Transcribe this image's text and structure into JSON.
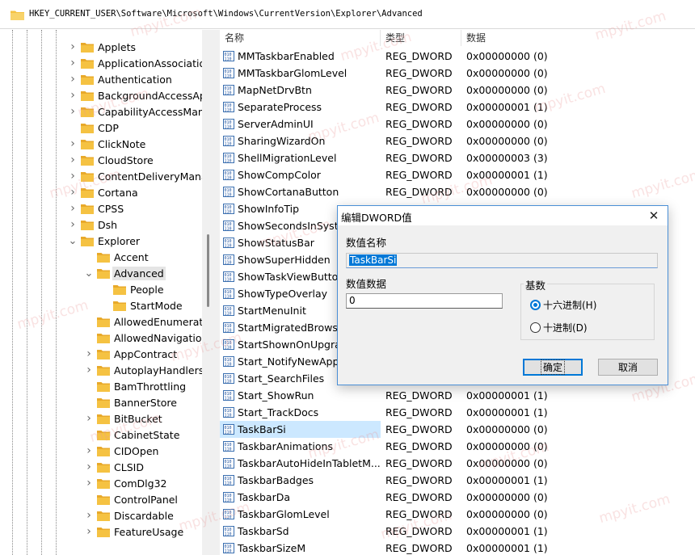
{
  "address": {
    "path": "HKEY_CURRENT_USER\\Software\\Microsoft\\Windows\\CurrentVersion\\Explorer\\Advanced"
  },
  "tree": {
    "items": [
      {
        "label": "Applets",
        "expand": "collapsed",
        "level": 0
      },
      {
        "label": "ApplicationAssociatio",
        "expand": "collapsed",
        "level": 0
      },
      {
        "label": "Authentication",
        "expand": "collapsed",
        "level": 0
      },
      {
        "label": "BackgroundAccessAp",
        "expand": "collapsed",
        "level": 0
      },
      {
        "label": "CapabilityAccessMana",
        "expand": "collapsed",
        "level": 0
      },
      {
        "label": "CDP",
        "expand": "none",
        "level": 0
      },
      {
        "label": "ClickNote",
        "expand": "collapsed",
        "level": 0
      },
      {
        "label": "CloudStore",
        "expand": "collapsed",
        "level": 0
      },
      {
        "label": "ContentDeliveryManag",
        "expand": "collapsed",
        "level": 0
      },
      {
        "label": "Cortana",
        "expand": "collapsed",
        "level": 0
      },
      {
        "label": "CPSS",
        "expand": "collapsed",
        "level": 0
      },
      {
        "label": "Dsh",
        "expand": "collapsed",
        "level": 0
      },
      {
        "label": "Explorer",
        "expand": "expanded",
        "level": 0
      },
      {
        "label": "Accent",
        "expand": "none",
        "level": 1
      },
      {
        "label": "Advanced",
        "expand": "expanded",
        "level": 1,
        "selected": true
      },
      {
        "label": "People",
        "expand": "none",
        "level": 2
      },
      {
        "label": "StartMode",
        "expand": "none",
        "level": 2
      },
      {
        "label": "AllowedEnumeratio",
        "expand": "none",
        "level": 1
      },
      {
        "label": "AllowedNavigation",
        "expand": "none",
        "level": 1
      },
      {
        "label": "AppContract",
        "expand": "collapsed",
        "level": 1
      },
      {
        "label": "AutoplayHandlers",
        "expand": "collapsed",
        "level": 1
      },
      {
        "label": "BamThrottling",
        "expand": "none",
        "level": 1
      },
      {
        "label": "BannerStore",
        "expand": "none",
        "level": 1
      },
      {
        "label": "BitBucket",
        "expand": "collapsed",
        "level": 1
      },
      {
        "label": "CabinetState",
        "expand": "none",
        "level": 1
      },
      {
        "label": "CIDOpen",
        "expand": "collapsed",
        "level": 1
      },
      {
        "label": "CLSID",
        "expand": "collapsed",
        "level": 1
      },
      {
        "label": "ComDlg32",
        "expand": "collapsed",
        "level": 1
      },
      {
        "label": "ControlPanel",
        "expand": "none",
        "level": 1
      },
      {
        "label": "Discardable",
        "expand": "collapsed",
        "level": 1
      },
      {
        "label": "FeatureUsage",
        "expand": "collapsed",
        "level": 1
      }
    ]
  },
  "list": {
    "headers": {
      "name": "名称",
      "type": "类型",
      "data": "数据"
    },
    "rows": [
      {
        "name": "MMTaskbarEnabled",
        "type": "REG_DWORD",
        "data": "0x00000000 (0)"
      },
      {
        "name": "MMTaskbarGlomLevel",
        "type": "REG_DWORD",
        "data": "0x00000000 (0)"
      },
      {
        "name": "MapNetDrvBtn",
        "type": "REG_DWORD",
        "data": "0x00000000 (0)"
      },
      {
        "name": "SeparateProcess",
        "type": "REG_DWORD",
        "data": "0x00000001 (1)"
      },
      {
        "name": "ServerAdminUI",
        "type": "REG_DWORD",
        "data": "0x00000000 (0)"
      },
      {
        "name": "SharingWizardOn",
        "type": "REG_DWORD",
        "data": "0x00000000 (0)"
      },
      {
        "name": "ShellMigrationLevel",
        "type": "REG_DWORD",
        "data": "0x00000003 (3)"
      },
      {
        "name": "ShowCompColor",
        "type": "REG_DWORD",
        "data": "0x00000001 (1)"
      },
      {
        "name": "ShowCortanaButton",
        "type": "REG_DWORD",
        "data": "0x00000000 (0)"
      },
      {
        "name": "ShowInfoTip",
        "type": "",
        "data": ""
      },
      {
        "name": "ShowSecondsInSyster",
        "type": "",
        "data": ""
      },
      {
        "name": "ShowStatusBar",
        "type": "",
        "data": ""
      },
      {
        "name": "ShowSuperHidden",
        "type": "",
        "data": ""
      },
      {
        "name": "ShowTaskViewButton",
        "type": "",
        "data": ""
      },
      {
        "name": "ShowTypeOverlay",
        "type": "",
        "data": ""
      },
      {
        "name": "StartMenuInit",
        "type": "",
        "data": ""
      },
      {
        "name": "StartMigratedBrowse",
        "type": "",
        "data": ""
      },
      {
        "name": "StartShownOnUpgrac",
        "type": "",
        "data": ""
      },
      {
        "name": "Start_NotifyNewApps",
        "type": "",
        "data": ""
      },
      {
        "name": "Start_SearchFiles",
        "type": "",
        "data": ""
      },
      {
        "name": "Start_ShowRun",
        "type": "REG_DWORD",
        "data": "0x00000001 (1)"
      },
      {
        "name": "Start_TrackDocs",
        "type": "REG_DWORD",
        "data": "0x00000001 (1)"
      },
      {
        "name": "TaskBarSi",
        "type": "REG_DWORD",
        "data": "0x00000000 (0)",
        "selected": true
      },
      {
        "name": "TaskbarAnimations",
        "type": "REG_DWORD",
        "data": "0x00000000 (0)"
      },
      {
        "name": "TaskbarAutoHideInTabletM...",
        "type": "REG_DWORD",
        "data": "0x00000000 (0)"
      },
      {
        "name": "TaskbarBadges",
        "type": "REG_DWORD",
        "data": "0x00000001 (1)"
      },
      {
        "name": "TaskbarDa",
        "type": "REG_DWORD",
        "data": "0x00000000 (0)"
      },
      {
        "name": "TaskbarGlomLevel",
        "type": "REG_DWORD",
        "data": "0x00000000 (0)"
      },
      {
        "name": "TaskbarSd",
        "type": "REG_DWORD",
        "data": "0x00000001 (1)"
      },
      {
        "name": "TaskbarSizeM",
        "type": "REG_DWORD",
        "data": "0x00000001 (1)"
      }
    ]
  },
  "dialog": {
    "title": "编辑DWORD值",
    "value_name_label": "数值名称",
    "value_name": "TaskBarSi",
    "value_data_label": "数值数据",
    "value_data": "0",
    "base_label": "基数",
    "hex_label": "十六进制(H)",
    "dec_label": "十进制(D)",
    "hex_selected": true,
    "ok_label": "确定",
    "cancel_label": "取消"
  },
  "watermark": "mpyit.com",
  "colors": {
    "selection": "#cce8ff",
    "accent": "#0078d7",
    "folder": "#f5c242"
  }
}
